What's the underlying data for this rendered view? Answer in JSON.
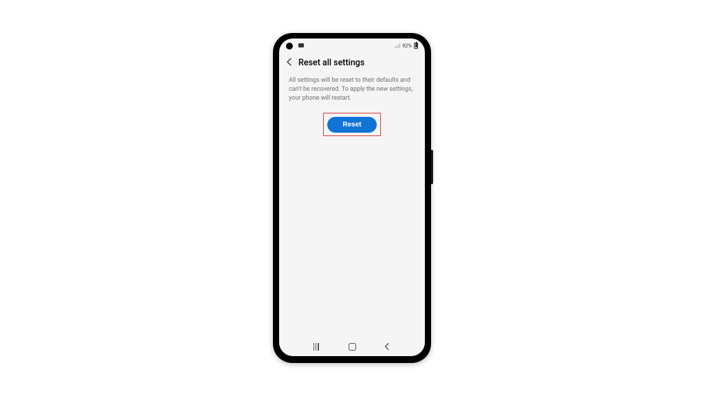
{
  "statusbar": {
    "battery_percent": "92%"
  },
  "header": {
    "title": "Reset all settings"
  },
  "body": {
    "description": "All settings will be reset to their defaults and can't be recovered. To apply the new settings, your phone will restart.",
    "reset_button_label": "Reset"
  },
  "colors": {
    "primary_button": "#1074d6",
    "highlight_border": "#e03a3a"
  }
}
